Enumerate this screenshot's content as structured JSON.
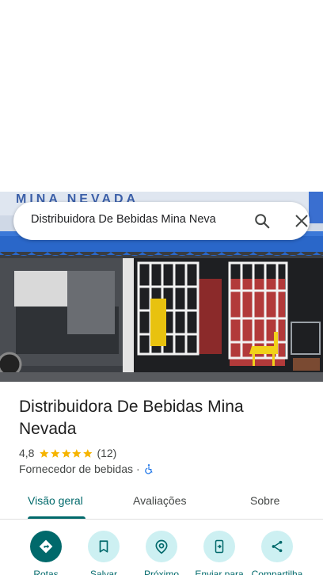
{
  "search": {
    "query": "Distribuidora De Bebidas Mina Neva"
  },
  "photo": {
    "sign_text": "MINA NEVADA"
  },
  "place": {
    "name": "Distribuidora De Bebidas Mina Nevada",
    "rating": "4,8",
    "rating_stars": 5,
    "review_count": "(12)",
    "category": "Fornecedor de bebidas",
    "separator": "·"
  },
  "tabs": [
    {
      "label": "Visão geral",
      "selected": true
    },
    {
      "label": "Avaliações",
      "selected": false
    },
    {
      "label": "Sobre",
      "selected": false
    }
  ],
  "actions": [
    {
      "label": "Rotas",
      "icon": "directions-icon"
    },
    {
      "label": "Salvar",
      "icon": "bookmark-icon"
    },
    {
      "label": "Próximo",
      "icon": "nearby-icon"
    },
    {
      "label": "Enviar para",
      "icon": "send-to-phone-icon"
    },
    {
      "label": "Compartilha",
      "icon": "share-icon"
    }
  ],
  "colors": {
    "accent": "#00696b",
    "accent_light": "#cdf0f2",
    "star": "#f6b400",
    "awning": "#2a67c9"
  }
}
